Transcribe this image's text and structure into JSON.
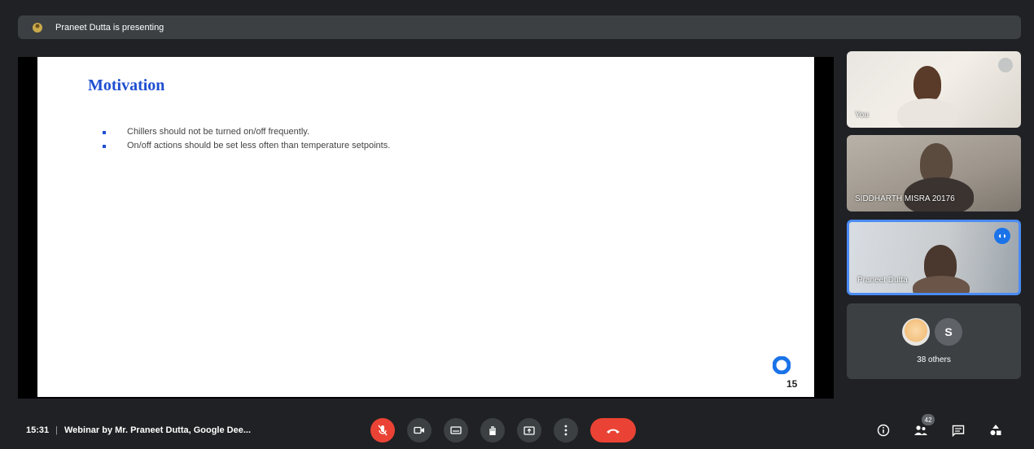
{
  "top_bar": {
    "presenting_text": "Praneet Dutta is presenting"
  },
  "slide": {
    "title": "Motivation",
    "bullets": [
      "Chillers should not be turned on/off frequently.",
      "On/off actions should be set less often than temperature setpoints."
    ],
    "page_number": "15"
  },
  "participants": {
    "tile_you": "You",
    "tile_2": "SIDDHARTH MISRA 20176",
    "tile_3": "Praneet Dutta",
    "others_avatar_letter": "S",
    "others_label": "38 others"
  },
  "bottom_bar": {
    "time": "15:31",
    "separator": "|",
    "meeting_title": "Webinar by Mr. Praneet Dutta, Google Dee...",
    "participants_count": "42"
  },
  "colors": {
    "accent": "#1a73e8",
    "danger": "#ea4335",
    "bar": "#3c4043",
    "background": "#202124"
  }
}
